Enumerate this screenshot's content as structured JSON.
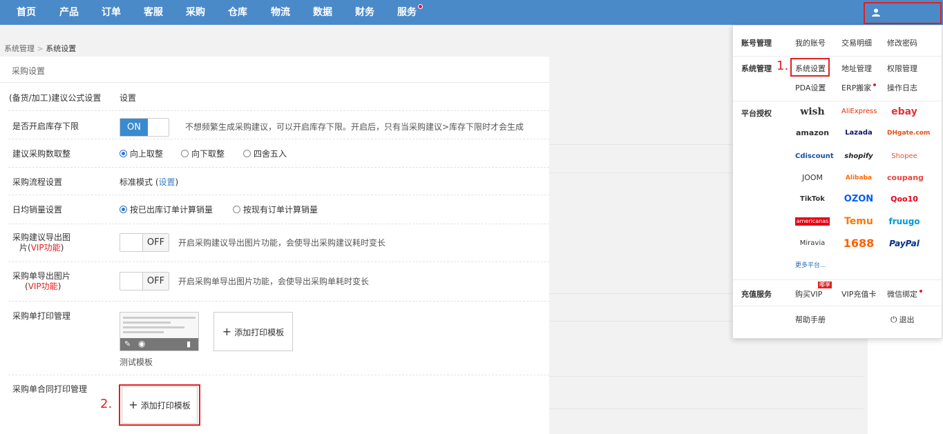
{
  "nav": {
    "items": [
      "首页",
      "产品",
      "订单",
      "客服",
      "采购",
      "仓库",
      "物流",
      "数据",
      "财务",
      "服务"
    ]
  },
  "breadcrumb": {
    "parent": "系统管理",
    "sep": ">",
    "current": "系统设置"
  },
  "panel": {
    "title": "采购设置",
    "formula": {
      "label": "(备货/加工)建议公式设置",
      "link": "设置"
    },
    "stock_floor": {
      "label": "是否开启库存下限",
      "toggle": "ON",
      "hint": "不想频繁生成采购建议，可以开启库存下限。开启后，只有当采购建议>库存下限时才会生成"
    },
    "rounding": {
      "label": "建议采购数取整",
      "options": [
        "向上取整",
        "向下取整",
        "四舍五入"
      ],
      "selected": 0
    },
    "flow": {
      "label": "采购流程设置",
      "value": "标准模式 (",
      "link": "设置",
      "close": ")"
    },
    "daily_sales": {
      "label": "日均销量设置",
      "options": [
        "按已出库订单计算销量",
        "按现有订单计算销量"
      ],
      "selected": 0
    },
    "suggest_export": {
      "label_a": "采购建议导出图",
      "label_b": "片(",
      "vip": "VIP功能",
      "label_c": ")",
      "toggle": "OFF",
      "hint": "开启采购建议导出图片功能，会使导出采购建议耗时变长"
    },
    "order_export": {
      "label_a": "采购单导出图片",
      "label_b": "(",
      "vip": "VIP功能",
      "label_c": ")",
      "toggle": "OFF",
      "hint": "开启采购单导出图片功能，会使导出采购单耗时变长"
    },
    "print_mgmt": {
      "label": "采购单打印管理",
      "template_name": "测试模板",
      "add_label": "添加打印模板"
    },
    "contract_print": {
      "label": "采购单合同打印管理",
      "add_label": "添加打印模板"
    }
  },
  "steps": {
    "one": "1.",
    "two": "2."
  },
  "dropdown": {
    "account": {
      "title": "账号管理",
      "links": [
        "我的账号",
        "交易明细",
        "修改密码"
      ]
    },
    "system": {
      "title": "系统管理",
      "links": [
        "系统设置",
        "地址管理",
        "权限管理",
        "PDA设置",
        "ERP搬家",
        "操作日志"
      ]
    },
    "platform": {
      "title": "平台授权",
      "logos": [
        "wish",
        "AliExpress",
        "ebay",
        "amazon",
        "Lazada",
        "DHgate.com",
        "Cdiscount",
        "shopify",
        "Shopee",
        "JOOM",
        "Alibaba",
        "coupang",
        "TikTok",
        "OZON",
        "Qoo10",
        "americanas",
        "Temu",
        "fruugo",
        "Miravia",
        "1688",
        "PayPal"
      ],
      "more": "更多平台..."
    },
    "recharge": {
      "title": "充值服务",
      "links": [
        "购买VIP",
        "VIP充值卡",
        "微信绑定"
      ],
      "badge": "嘟享"
    },
    "help": "帮助手册",
    "logout": "退出"
  }
}
